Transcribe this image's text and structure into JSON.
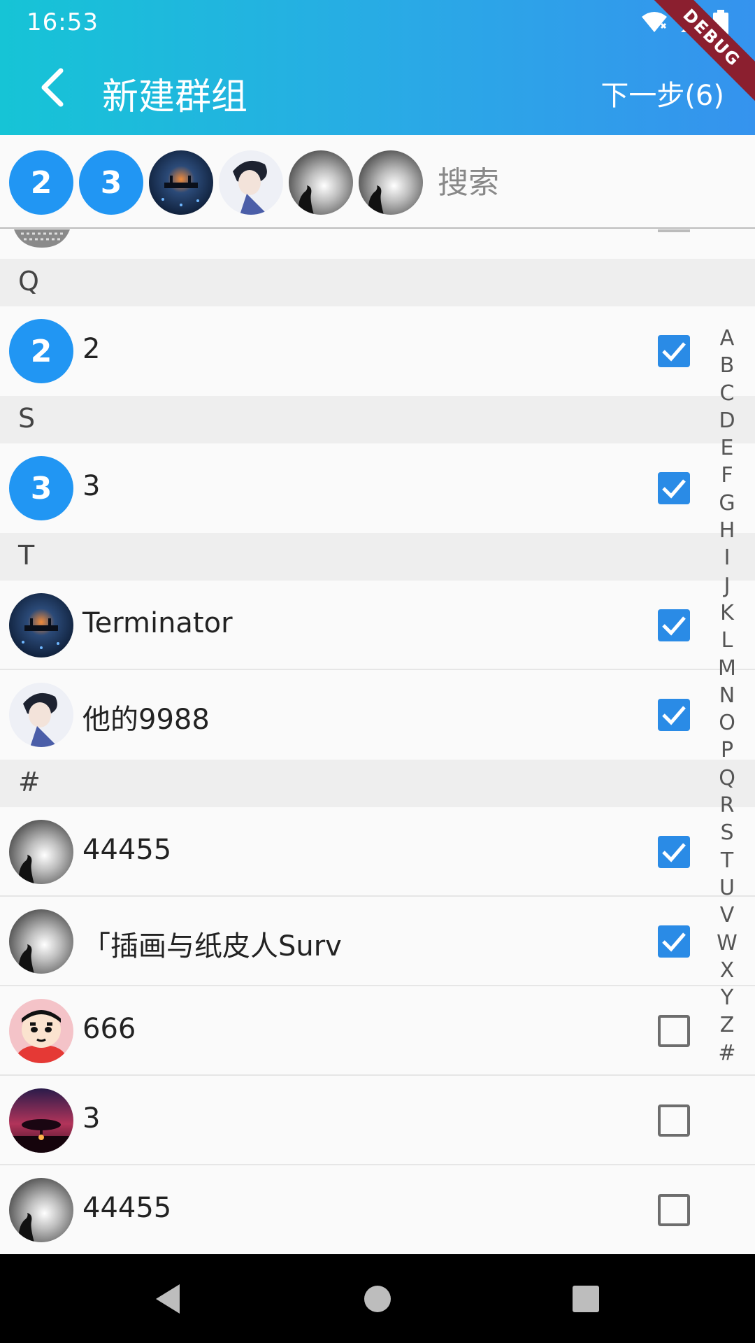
{
  "status_bar": {
    "time": "16:53",
    "debug_label": "DEBUG"
  },
  "app_bar": {
    "title": "新建群组",
    "next_label": "下一步(6)",
    "back_icon": "arrow-back-icon"
  },
  "selected_strip": {
    "chips": [
      {
        "type": "letter",
        "label": "2"
      },
      {
        "type": "letter",
        "label": "3"
      },
      {
        "type": "image",
        "icon": "night-boat-avatar"
      },
      {
        "type": "image",
        "icon": "anime-boy-avatar"
      },
      {
        "type": "image",
        "icon": "gray-silhouette-avatar"
      },
      {
        "type": "image",
        "icon": "gray-silhouette-avatar"
      }
    ],
    "search_placeholder": "搜索"
  },
  "sections": [
    {
      "letter": "Q",
      "items": [
        {
          "name": "2",
          "avatar": {
            "type": "letter",
            "label": "2"
          },
          "checked": true
        }
      ]
    },
    {
      "letter": "S",
      "items": [
        {
          "name": "3",
          "avatar": {
            "type": "letter",
            "label": "3"
          },
          "checked": true
        }
      ]
    },
    {
      "letter": "T",
      "items": [
        {
          "name": "Terminator",
          "avatar": {
            "type": "image",
            "icon": "night-boat-avatar"
          },
          "checked": true
        },
        {
          "name": "他的9988",
          "avatar": {
            "type": "image",
            "icon": "anime-boy-avatar"
          },
          "checked": true
        }
      ]
    },
    {
      "letter": "#",
      "items": [
        {
          "name": "44455",
          "avatar": {
            "type": "image",
            "icon": "gray-silhouette-avatar"
          },
          "checked": true
        },
        {
          "name": "「插画与纸皮人Surv",
          "avatar": {
            "type": "image",
            "icon": "gray-silhouette-avatar"
          },
          "checked": true
        },
        {
          "name": "666",
          "avatar": {
            "type": "image",
            "icon": "cartoon-boy-avatar"
          },
          "checked": false
        },
        {
          "name": "3",
          "avatar": {
            "type": "image",
            "icon": "sunset-tree-avatar"
          },
          "checked": false
        },
        {
          "name": "44455",
          "avatar": {
            "type": "image",
            "icon": "gray-silhouette-avatar"
          },
          "checked": false
        }
      ]
    }
  ],
  "alphabet_index": [
    "A",
    "B",
    "C",
    "D",
    "E",
    "F",
    "G",
    "H",
    "I",
    "J",
    "K",
    "L",
    "M",
    "N",
    "O",
    "P",
    "Q",
    "R",
    "S",
    "T",
    "U",
    "V",
    "W",
    "X",
    "Y",
    "Z",
    "#"
  ],
  "colors": {
    "app_bar_start": "#16c4d6",
    "app_bar_end": "#3593ee",
    "accent": "#2196f3",
    "checkbox_checked": "#2a8be6",
    "section_bg": "#eeeeee"
  },
  "nav_bar": {
    "back_icon": "nav-back-icon",
    "home_icon": "nav-home-icon",
    "recents_icon": "nav-recents-icon"
  }
}
